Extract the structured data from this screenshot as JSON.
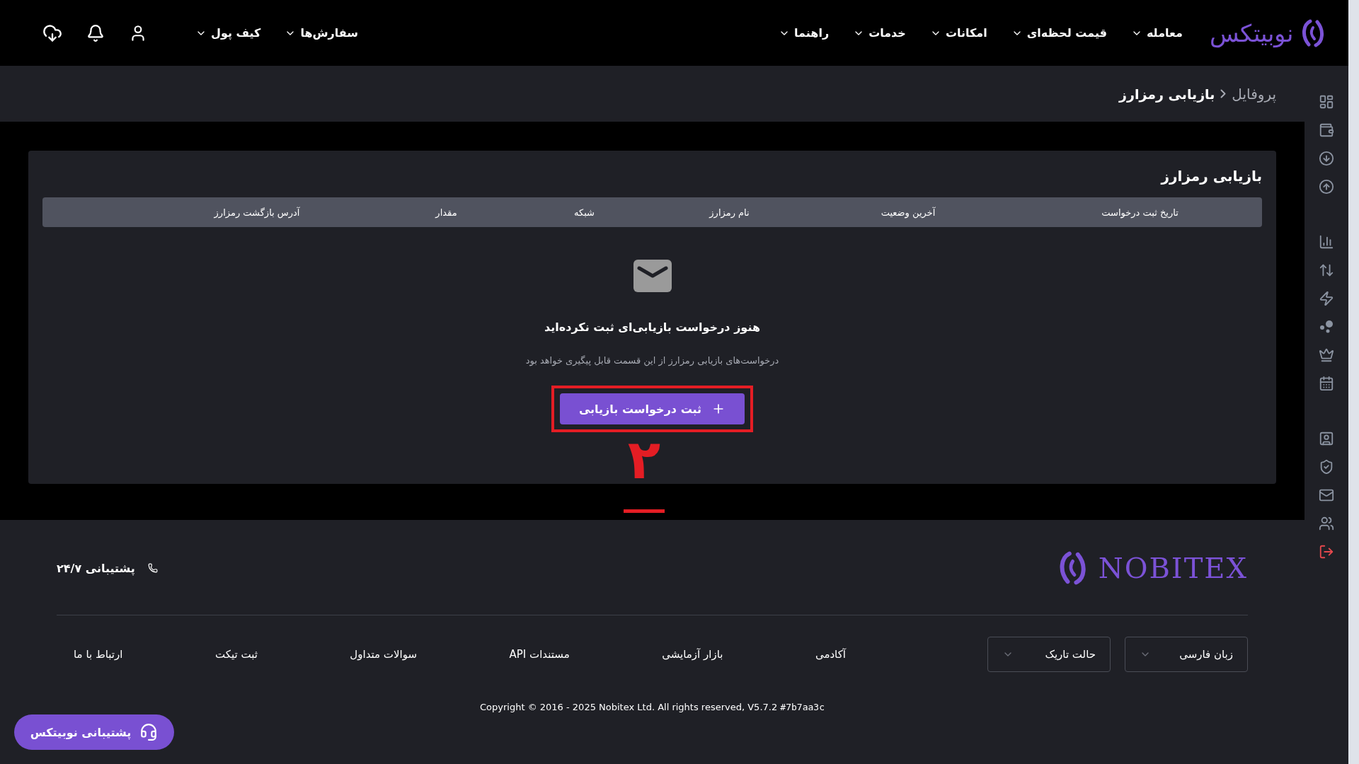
{
  "header": {
    "logo_text": "نوبیتکس",
    "nav": [
      {
        "label": "معامله"
      },
      {
        "label": "قیمت لحظه‌ای"
      },
      {
        "label": "امکانات"
      },
      {
        "label": "خدمات"
      },
      {
        "label": "راهنما"
      }
    ],
    "account_menu": [
      {
        "label": "سفارش‌ها"
      },
      {
        "label": "کیف پول"
      }
    ]
  },
  "breadcrumb": [
    {
      "label": "پروفایل",
      "current": false
    },
    {
      "label": "بازیابی رمزارز",
      "current": true
    }
  ],
  "card": {
    "title": "بازیابی رمزارز",
    "table": {
      "columns": [
        "تاریخ ثبت درخواست",
        "آخرین وضعیت",
        "نام رمزارز",
        "شبکه",
        "مقدار",
        "آدرس بازگشت رمزارز"
      ]
    },
    "empty_state": {
      "title": "هنوز درخواست بازیابی‌ای ثبت نکرده‌اید",
      "description": "درخواست‌های بازیابی رمزارز از این قسمت قابل پیگیری خواهد بود",
      "button": "ثبت درخواست بازیابی"
    }
  },
  "annotation": {
    "label": "۲"
  },
  "footer": {
    "logo_text": "NOBITEX",
    "support": "پشتیبانی ۲۴/۷",
    "selects": [
      {
        "value": "زبان فارسی"
      },
      {
        "value": "حالت تاریک"
      }
    ],
    "links": [
      "آکادمی",
      "بازار آزمایشی",
      "مستندات API",
      "سوالات متداول",
      "ثبت تیکت",
      "ارتباط با ما"
    ],
    "copyright": "Copyright © 2016 - 2025 Nobitex Ltd. All rights reserved, V5.7.2",
    "build_hash": "#7b7aa3c"
  },
  "support_button": "پشتیبانی نوبیتکس"
}
